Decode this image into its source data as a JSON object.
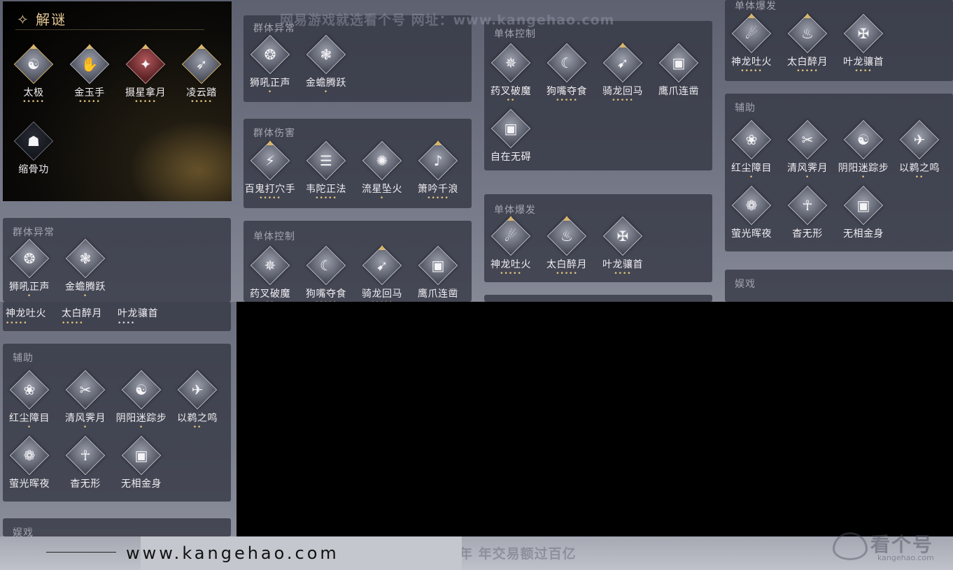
{
  "jiemi": {
    "title": "解谜",
    "title_icon": "✧",
    "skills": [
      {
        "name": "太极",
        "glyph": "☯",
        "tone": "gold",
        "pip": true,
        "dots": "•••••"
      },
      {
        "name": "金玉手",
        "glyph": "✋",
        "tone": "normal",
        "pip": true,
        "dots": "•••••"
      },
      {
        "name": "摄星拿月",
        "glyph": "✦",
        "tone": "red",
        "pip": true,
        "dots": "•••••"
      },
      {
        "name": "凌云踏",
        "glyph": "➶",
        "tone": "gold",
        "pip": true,
        "dots": "•••••"
      },
      {
        "name": "缩骨功",
        "glyph": "☗",
        "tone": "dark",
        "pip": false,
        "dots": ""
      }
    ]
  },
  "cards": {
    "qunti_yichang": {
      "title": "群体异常",
      "skills": [
        {
          "name": "狮吼正声",
          "glyph": "❂",
          "dots": "•"
        },
        {
          "name": "金蟾腾跃",
          "glyph": "❃",
          "dots": "•"
        }
      ]
    },
    "qunti_shanghai": {
      "title": "群体伤害",
      "skills": [
        {
          "name": "百鬼打穴手",
          "glyph": "⚡",
          "dots": "•••••",
          "pip": true
        },
        {
          "name": "韦陀正法",
          "glyph": "☰",
          "dots": "•••••"
        },
        {
          "name": "流星坠火",
          "glyph": "✺",
          "dots": "•"
        },
        {
          "name": "箫吟千浪",
          "glyph": "♪",
          "dots": "•••••",
          "pip": true
        }
      ]
    },
    "danti_kongzhi": {
      "title": "单体控制",
      "skills": [
        {
          "name": "药叉破魔",
          "glyph": "✵",
          "dots": "••"
        },
        {
          "name": "狗嘴夺食",
          "glyph": "☾",
          "dots": "•••••"
        },
        {
          "name": "骑龙回马",
          "glyph": "➹",
          "dots": "•••••",
          "pip": true
        },
        {
          "name": "鹰爪连凿",
          "glyph": "▣",
          "dots": ""
        },
        {
          "name": "自在无碍",
          "glyph": "▣",
          "dots": ""
        }
      ]
    },
    "danti_baofa": {
      "title": "单体爆发",
      "skills": [
        {
          "name": "神龙吐火",
          "glyph": "☄",
          "dots": "•••••",
          "pip": true
        },
        {
          "name": "太白醉月",
          "glyph": "♨",
          "dots": "•••••",
          "pip": true
        },
        {
          "name": "叶龙骧首",
          "glyph": "✠",
          "dots": "••••"
        }
      ]
    },
    "fuzhu": {
      "title": "辅助",
      "skills": [
        {
          "name": "红尘障目",
          "glyph": "❀",
          "dots": "•"
        },
        {
          "name": "清风霁月",
          "glyph": "✂",
          "dots": "•"
        },
        {
          "name": "阴阳迷踪步",
          "glyph": "☯",
          "dots": "•"
        },
        {
          "name": "以鹈之鸣",
          "glyph": "✈",
          "dots": "••"
        },
        {
          "name": "萤光晖夜",
          "glyph": "❁",
          "dots": ""
        },
        {
          "name": "杳无形",
          "glyph": "☥",
          "dots": ""
        },
        {
          "name": "无相金身",
          "glyph": "▣",
          "dots": ""
        }
      ]
    },
    "yuxi": {
      "title": "娱戏"
    },
    "bottom_baofa_names": [
      "神龙吐火",
      "太白醉月",
      "叶龙骧首"
    ],
    "bottom_baofa_dots": [
      "•••••",
      "•••••",
      "••••"
    ]
  },
  "watermarks": {
    "top": "网易游戏就选看个号  网址：www.kangehao.com",
    "bottom": "看个号专业网易游戏八年  年交易额过百亿",
    "url": "www.kangehao.com",
    "logo": "看个号",
    "logo_sub": "kangehao.com"
  }
}
